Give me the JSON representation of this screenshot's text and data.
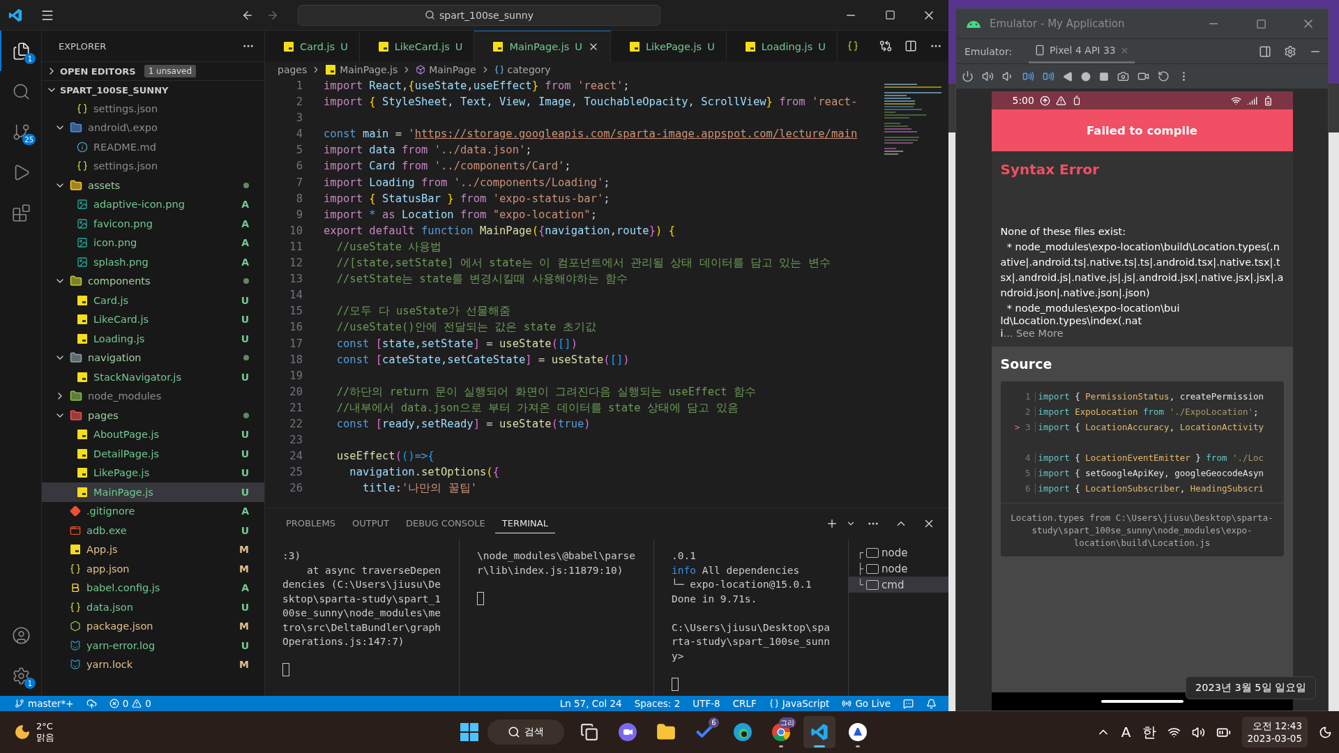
{
  "title_bar": {
    "search": "spart_100se_sunny"
  },
  "activity_bar": {
    "top": [
      {
        "kind": "files",
        "selected": true,
        "badge": "1"
      },
      {
        "kind": "search",
        "selected": false
      },
      {
        "kind": "scm",
        "selected": false,
        "badge": "25"
      },
      {
        "kind": "debug",
        "selected": false
      },
      {
        "kind": "extensions",
        "selected": false
      }
    ],
    "bottom": [
      {
        "kind": "account",
        "selected": false
      },
      {
        "kind": "manage",
        "selected": false,
        "badge": "1"
      }
    ]
  },
  "explorer": {
    "title": "EXPLORER",
    "open_editors": {
      "label": "OPEN EDITORS",
      "badge": "1 unsaved",
      "expanded": false
    },
    "root": {
      "label": "SPART_100SE_SUNNY",
      "expanded": true
    },
    "tree": [
      {
        "children": [
          {
            "name": "settings.json",
            "kind": "json",
            "selected": false
          }
        ]
      },
      {
        "name": "android\\.expo",
        "kind": "android-folder",
        "expanded": true,
        "selected": false,
        "children": [
          {
            "name": "README.md",
            "kind": "info",
            "selected": false
          },
          {
            "name": "settings.json",
            "kind": "json",
            "selected": false
          }
        ]
      },
      {
        "name": "assets",
        "kind": "assets-folder",
        "expanded": true,
        "dot": true,
        "selected": false,
        "children": [
          {
            "name": "adaptive-icon.png",
            "kind": "image",
            "status": "A",
            "selected": false
          },
          {
            "name": "favicon.png",
            "kind": "image",
            "status": "A",
            "selected": false
          },
          {
            "name": "icon.png",
            "kind": "image",
            "status": "A",
            "selected": false
          },
          {
            "name": "splash.png",
            "kind": "image",
            "status": "A",
            "selected": false
          }
        ]
      },
      {
        "name": "components",
        "kind": "components-folder",
        "expanded": true,
        "dot": true,
        "selected": false,
        "children": [
          {
            "name": "Card.js",
            "kind": "js",
            "status": "U",
            "selected": false
          },
          {
            "name": "LikeCard.js",
            "kind": "js",
            "status": "U",
            "selected": false
          },
          {
            "name": "Loading.js",
            "kind": "js",
            "status": "U",
            "selected": false
          }
        ]
      },
      {
        "name": "navigation",
        "kind": "folder",
        "expanded": true,
        "dot": true,
        "selected": false,
        "children": [
          {
            "name": "StackNavigator.js",
            "kind": "js",
            "status": "U",
            "selected": false
          }
        ]
      },
      {
        "name": "node_modules",
        "kind": "node-folder",
        "expanded": false,
        "selected": false
      },
      {
        "name": "pages",
        "kind": "pages-folder",
        "expanded": true,
        "dot": true,
        "selected": false,
        "children": [
          {
            "name": "AboutPage.js",
            "kind": "js",
            "status": "U",
            "selected": false
          },
          {
            "name": "DetailPage.js",
            "kind": "js",
            "status": "U",
            "selected": false
          },
          {
            "name": "LikePage.js",
            "kind": "js",
            "status": "U",
            "selected": false
          },
          {
            "name": "MainPage.js",
            "kind": "js",
            "status": "U",
            "selected": true
          }
        ]
      },
      {
        "name": ".gitignore",
        "kind": "git",
        "status": "A",
        "selected": false
      },
      {
        "name": "adb.exe",
        "kind": "exe",
        "status": "U",
        "selected": false
      },
      {
        "name": "App.js",
        "kind": "js",
        "status": "M",
        "selected": false
      },
      {
        "name": "app.json",
        "kind": "json",
        "status": "M",
        "selected": false
      },
      {
        "name": "babel.config.js",
        "kind": "babel",
        "status": "A",
        "selected": false
      },
      {
        "name": "data.json",
        "kind": "json",
        "status": "U",
        "selected": false
      },
      {
        "name": "package.json",
        "kind": "node",
        "status": "M",
        "selected": false
      },
      {
        "name": "yarn-error.log",
        "kind": "yarn",
        "status": "U",
        "selected": false
      },
      {
        "name": "yarn.lock",
        "kind": "yarn",
        "status": "M",
        "selected": false
      }
    ]
  },
  "tabs": [
    {
      "name": "Card.js",
      "kind": "js",
      "status": "U",
      "selected": false
    },
    {
      "name": "LikeCard.js",
      "kind": "js",
      "status": "U",
      "selected": false
    },
    {
      "name": "MainPage.js",
      "kind": "js",
      "status": "U",
      "selected": true
    },
    {
      "name": "LikePage.js",
      "kind": "js",
      "status": "U",
      "selected": false
    },
    {
      "name": "Loading.js",
      "kind": "js",
      "status": "U",
      "selected": false
    },
    {
      "kind": "json",
      "selected": false
    }
  ],
  "breadcrumb": [
    {
      "text": "pages"
    },
    {
      "text": "MainPage.js",
      "kind": "js"
    },
    {
      "text": "MainPage",
      "kind": "component"
    },
    {
      "text": "category",
      "kind": "field"
    }
  ],
  "code": [
    {
      "n": "1",
      "tokens": [
        {
          "kind": "kw",
          "text": "import "
        },
        {
          "kind": "v",
          "text": "React"
        },
        {
          "kind": "p",
          "text": ","
        },
        {
          "kind": "b1",
          "text": "{"
        },
        {
          "kind": "v",
          "text": "useState"
        },
        {
          "kind": "p",
          "text": ","
        },
        {
          "kind": "v",
          "text": "useEffect"
        },
        {
          "kind": "b1",
          "text": "}"
        },
        {
          "kind": "kw",
          "text": " from "
        },
        {
          "kind": "s",
          "text": "'react'"
        },
        {
          "kind": "p",
          "text": ";"
        }
      ]
    },
    {
      "n": "2",
      "tokens": [
        {
          "kind": "kw",
          "text": "import "
        },
        {
          "kind": "b1",
          "text": "{ "
        },
        {
          "kind": "v",
          "text": "StyleSheet, Text, View, Image, TouchableOpacity, ScrollView"
        },
        {
          "kind": "b1",
          "text": "}"
        },
        {
          "kind": "kw",
          "text": " from "
        },
        {
          "kind": "s",
          "text": "'react-"
        }
      ]
    },
    {
      "n": "3"
    },
    {
      "n": "4",
      "tokens": [
        {
          "kind": "d",
          "text": "const "
        },
        {
          "kind": "v",
          "text": "main"
        },
        {
          "kind": "p",
          "text": " = "
        },
        {
          "kind": "s",
          "text": "'"
        },
        {
          "kind": "url",
          "text": "https://storage.googleapis.com/sparta-image.appspot.com/lecture/main"
        }
      ]
    },
    {
      "n": "5",
      "tokens": [
        {
          "kind": "kw",
          "text": "import "
        },
        {
          "kind": "v",
          "text": "data"
        },
        {
          "kind": "kw",
          "text": " from "
        },
        {
          "kind": "s",
          "text": "'../data.json'"
        },
        {
          "kind": "p",
          "text": ";"
        }
      ]
    },
    {
      "n": "6",
      "tokens": [
        {
          "kind": "kw",
          "text": "import "
        },
        {
          "kind": "v",
          "text": "Card"
        },
        {
          "kind": "kw",
          "text": " from "
        },
        {
          "kind": "s",
          "text": "'../components/Card'"
        },
        {
          "kind": "p",
          "text": ";"
        }
      ]
    },
    {
      "n": "7",
      "tokens": [
        {
          "kind": "kw",
          "text": "import "
        },
        {
          "kind": "v",
          "text": "Loading"
        },
        {
          "kind": "kw",
          "text": " from "
        },
        {
          "kind": "s",
          "text": "'../components/Loading'"
        },
        {
          "kind": "p",
          "text": ";"
        }
      ]
    },
    {
      "n": "8",
      "tokens": [
        {
          "kind": "kw",
          "text": "import "
        },
        {
          "kind": "b1",
          "text": "{ "
        },
        {
          "kind": "v",
          "text": "StatusBar"
        },
        {
          "kind": "b1",
          "text": " }"
        },
        {
          "kind": "kw",
          "text": " from "
        },
        {
          "kind": "s",
          "text": "'expo-status-bar'"
        },
        {
          "kind": "p",
          "text": ";"
        }
      ]
    },
    {
      "n": "9",
      "tokens": [
        {
          "kind": "kw",
          "text": "import "
        },
        {
          "kind": "d",
          "text": "* "
        },
        {
          "kind": "kw",
          "text": "as "
        },
        {
          "kind": "v",
          "text": "Location"
        },
        {
          "kind": "kw",
          "text": " from "
        },
        {
          "kind": "s",
          "text": "\"expo-location\""
        },
        {
          "kind": "p",
          "text": ";"
        }
      ]
    },
    {
      "n": "10",
      "tokens": [
        {
          "kind": "kw",
          "text": "export default "
        },
        {
          "kind": "d",
          "text": "function "
        },
        {
          "kind": "f",
          "text": "MainPage"
        },
        {
          "kind": "b1",
          "text": "("
        },
        {
          "kind": "b2",
          "text": "{"
        },
        {
          "kind": "v",
          "text": "navigation"
        },
        {
          "kind": "p",
          "text": ","
        },
        {
          "kind": "v",
          "text": "route"
        },
        {
          "kind": "b2",
          "text": "}"
        },
        {
          "kind": "b1",
          "text": ") {"
        }
      ]
    },
    {
      "n": "11",
      "tokens": [
        {
          "kind": "c",
          "text": "  //useState 사용법"
        }
      ]
    },
    {
      "n": "12",
      "tokens": [
        {
          "kind": "c",
          "text": "  //[state,setState] 에서 state는 이 컴포넌트에서 관리될 상태 데이터를 담고 있는 변수"
        }
      ]
    },
    {
      "n": "13",
      "tokens": [
        {
          "kind": "c",
          "text": "  //setState는 state를 변경시킬때 사용해야하는 함수"
        }
      ]
    },
    {
      "n": "14"
    },
    {
      "n": "15",
      "tokens": [
        {
          "kind": "c",
          "text": "  //모두 다 useState가 선물해줌"
        }
      ]
    },
    {
      "n": "16",
      "tokens": [
        {
          "kind": "c",
          "text": "  //useState()안에 전달되는 값은 state 초기값"
        }
      ]
    },
    {
      "n": "17",
      "tokens": [
        {
          "kind": "d",
          "text": "  const "
        },
        {
          "kind": "b2",
          "text": "["
        },
        {
          "kind": "v",
          "text": "state,setState"
        },
        {
          "kind": "b2",
          "text": "]"
        },
        {
          "kind": "p",
          "text": " = "
        },
        {
          "kind": "f",
          "text": "useState"
        },
        {
          "kind": "b2",
          "text": "("
        },
        {
          "kind": "b3",
          "text": "[]"
        },
        {
          "kind": "b2",
          "text": ")"
        }
      ]
    },
    {
      "n": "18",
      "tokens": [
        {
          "kind": "d",
          "text": "  const "
        },
        {
          "kind": "b2",
          "text": "["
        },
        {
          "kind": "v",
          "text": "cateState,setCateState"
        },
        {
          "kind": "b2",
          "text": "]"
        },
        {
          "kind": "p",
          "text": " = "
        },
        {
          "kind": "f",
          "text": "useState"
        },
        {
          "kind": "b2",
          "text": "("
        },
        {
          "kind": "b3",
          "text": "[]"
        },
        {
          "kind": "b2",
          "text": ")"
        }
      ]
    },
    {
      "n": "19"
    },
    {
      "n": "20",
      "tokens": [
        {
          "kind": "c",
          "text": "  //하단의 return 문이 실행되어 화면이 그려진다음 실행되는 useEffect 함수"
        }
      ]
    },
    {
      "n": "21",
      "tokens": [
        {
          "kind": "c",
          "text": "  //내부에서 data.json으로 부터 가져온 데이터를 state 상태에 담고 있음"
        }
      ]
    },
    {
      "n": "22",
      "tokens": [
        {
          "kind": "d",
          "text": "  const "
        },
        {
          "kind": "b2",
          "text": "["
        },
        {
          "kind": "v",
          "text": "ready,setReady"
        },
        {
          "kind": "b2",
          "text": "]"
        },
        {
          "kind": "p",
          "text": " = "
        },
        {
          "kind": "f",
          "text": "useState"
        },
        {
          "kind": "b2",
          "text": "("
        },
        {
          "kind": "d",
          "text": "true"
        },
        {
          "kind": "b2",
          "text": ")"
        }
      ]
    },
    {
      "n": "23"
    },
    {
      "n": "24",
      "tokens": [
        {
          "kind": "f",
          "text": "  useEffect"
        },
        {
          "kind": "b2",
          "text": "("
        },
        {
          "kind": "b3",
          "text": "()"
        },
        {
          "kind": "d",
          "text": "=>"
        },
        {
          "kind": "b3",
          "text": "{"
        }
      ]
    },
    {
      "n": "25",
      "tokens": [
        {
          "kind": "v",
          "text": "    navigation"
        },
        {
          "kind": "p",
          "text": "."
        },
        {
          "kind": "f",
          "text": "setOptions"
        },
        {
          "kind": "b1",
          "text": "("
        },
        {
          "kind": "b2",
          "text": "{"
        }
      ]
    },
    {
      "n": "26",
      "tokens": [
        {
          "kind": "v",
          "text": "      title"
        },
        {
          "kind": "p",
          "text": ":"
        },
        {
          "kind": "s",
          "text": "'나만의 꿀팁'"
        }
      ]
    }
  ],
  "panel": {
    "tabs": [
      {
        "label": "PROBLEMS",
        "selected": false
      },
      {
        "label": "OUTPUT",
        "selected": false
      },
      {
        "label": "DEBUG CONSOLE",
        "selected": false
      },
      {
        "label": "TERMINAL",
        "selected": true
      }
    ],
    "panes": [
      {
        "cursor": true,
        "blocks": [
          [
            [
              {
                "kind": "t",
                "text": ":3)"
              }
            ],
            [
              {
                "kind": "t",
                "text": "    at async traverseDependencies (C:\\Users\\jiusu\\Desktop\\sparta-study\\spart_100se_sunny\\node_modules\\metro\\src\\DeltaBundler\\graphOperations.js:147:7)"
              }
            ]
          ]
        ]
      },
      {
        "cursor": true,
        "blocks": [
          [
            [
              {
                "kind": "t",
                "text": "\\node_modules\\@babel\\parser\\lib\\index.js:11879:10)"
              }
            ]
          ]
        ]
      },
      {
        "cursor": true,
        "blocks": [
          [
            [
              {
                "kind": "t",
                "text": ".0.1"
              }
            ],
            [
              {
                "kind": "info",
                "text": "info"
              },
              {
                "kind": "t",
                "text": " All dependencies"
              }
            ],
            [
              {
                "kind": "t",
                "text": "└─ expo-location@15.0.1"
              }
            ],
            [
              {
                "kind": "t",
                "text": "Done in 9.71s."
              }
            ]
          ],
          [
            [
              {
                "kind": "t",
                "text": "C:\\Users\\jiusu\\Desktop\\sparta-study\\spart_100se_sunny>"
              }
            ]
          ]
        ]
      }
    ],
    "terminals": [
      {
        "prefix": "┌",
        "name": "node",
        "selected": false
      },
      {
        "prefix": "├",
        "name": "node",
        "selected": false
      },
      {
        "prefix": "└",
        "name": "cmd",
        "selected": true
      }
    ]
  },
  "status_bar": {
    "left": [
      {
        "kind": "branch",
        "text": "master*+"
      },
      {
        "kind": "sync"
      },
      {
        "kind": "problems",
        "errors": "0",
        "warnings": "0"
      }
    ],
    "right": [
      {
        "kind": "text",
        "text": "Ln 57, Col 24"
      },
      {
        "kind": "text",
        "text": "Spaces: 2"
      },
      {
        "kind": "text",
        "text": "UTF-8"
      },
      {
        "kind": "text",
        "text": "CRLF"
      },
      {
        "kind": "language",
        "text": "JavaScript"
      },
      {
        "kind": "golive",
        "text": "Go Live"
      },
      {
        "kind": "feedback"
      },
      {
        "kind": "bell"
      }
    ]
  },
  "emulator": {
    "title": "Emulator - My Application",
    "label": "Emulator:",
    "device_tab": "Pixel 4 API 33",
    "phone": {
      "time": "5:00",
      "banner": "Failed to compile",
      "error_title": "Syntax Error",
      "message": "None of these files exist:",
      "paths": [
        "  * node_modules\\expo-location\\build\\Location.types(.native|.android.ts|.native.ts|.ts|.android.tsx|.native.tsx|.tsx|.android.js|.native.js|.js|.android.jsx|.native.jsx|.jsx|.android.json|.native.json|.json)",
        "  * node_modules\\expo-location\\build\\Location.types\\index(.nati"
      ],
      "more": "... See More",
      "source": {
        "title": "Source",
        "lines": [
          {
            "n": "1",
            "tokens": [
              {
                "kind": "ek",
                "text": "import"
              },
              {
                "kind": "ew",
                "text": " { "
              },
              {
                "kind": "ey",
                "text": "PermissionStatus"
              },
              {
                "kind": "ew",
                "text": ", createPermission"
              }
            ]
          },
          {
            "n": "2",
            "tokens": [
              {
                "kind": "ek",
                "text": "import "
              },
              {
                "kind": "ey",
                "text": "ExpoLocation "
              },
              {
                "kind": "ek",
                "text": "from "
              },
              {
                "kind": "es",
                "text": "'./ExpoLocation'"
              },
              {
                "kind": "ew",
                "text": ";"
              }
            ]
          },
          {
            "n": "3",
            "marker": ">",
            "tokens": [
              {
                "kind": "ek",
                "text": "import"
              },
              {
                "kind": "ew",
                "text": " { "
              },
              {
                "kind": "ey",
                "text": "LocationAccuracy"
              },
              {
                "kind": "ew",
                "text": ", "
              },
              {
                "kind": "ey",
                "text": "LocationActivity"
              }
            ]
          },
          {
            "n": "4",
            "tokens": [
              {
                "kind": "ek",
                "text": "import"
              },
              {
                "kind": "ew",
                "text": " { "
              },
              {
                "kind": "ey",
                "text": "LocationEventEmitter"
              },
              {
                "kind": "ew",
                "text": " } "
              },
              {
                "kind": "ek",
                "text": "from "
              },
              {
                "kind": "es",
                "text": "'./Loc"
              }
            ]
          },
          {
            "n": "5",
            "tokens": [
              {
                "kind": "ek",
                "text": "import"
              },
              {
                "kind": "ew",
                "text": " { setGoogleApiKey, googleGeocodeAsyn"
              }
            ]
          },
          {
            "n": "6",
            "tokens": [
              {
                "kind": "ek",
                "text": "import"
              },
              {
                "kind": "ew",
                "text": " { "
              },
              {
                "kind": "ey",
                "text": "LocationSubscriber"
              },
              {
                "kind": "ew",
                "text": ", "
              },
              {
                "kind": "ey",
                "text": "HeadingSubscri"
              }
            ]
          }
        ],
        "footer": "Location.types from C:\\Users\\jiusu\\Desktop\\sparta-study\\spart_100se_sunny\\node_modules\\expo-location\\build\\Location.js"
      }
    }
  },
  "date_tooltip": "2023년 3월 5일 일요일",
  "taskbar": {
    "weather": {
      "temp": "2°C",
      "condition": "맑음"
    },
    "search": "검색",
    "apps": [
      {
        "kind": "taskview",
        "running": false,
        "selected": false
      },
      {
        "kind": "chat",
        "running": false,
        "selected": false
      },
      {
        "kind": "files",
        "running": false,
        "selected": false
      },
      {
        "kind": "todo",
        "badge": "6",
        "running": false,
        "selected": false
      },
      {
        "kind": "edge",
        "running": false,
        "selected": false
      },
      {
        "kind": "chrome",
        "badge": "그리",
        "running": true,
        "selected": false
      },
      {
        "kind": "vscode",
        "running": true,
        "selected": true
      },
      {
        "kind": "app",
        "running": true,
        "selected": false
      }
    ],
    "tray": {
      "ime_mode": "A",
      "ime_lang": "한",
      "time": "오전 12:43",
      "date": "2023-03-05"
    }
  }
}
